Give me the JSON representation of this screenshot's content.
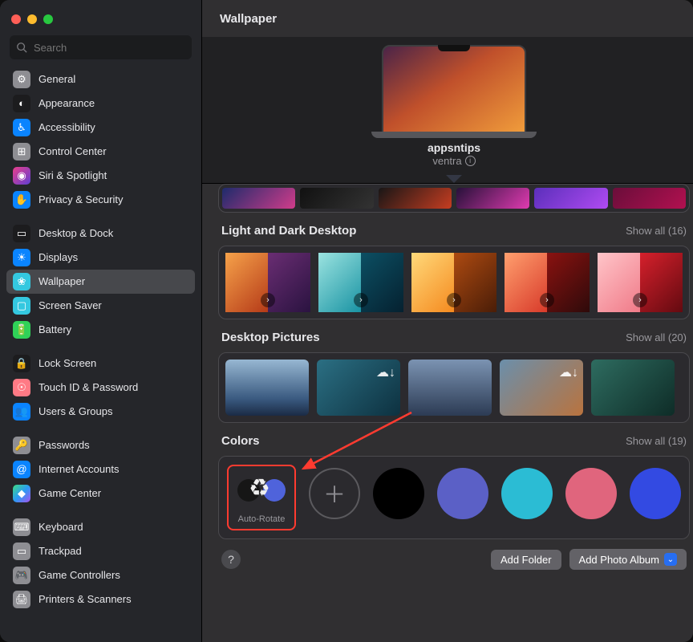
{
  "window_title": "Wallpaper",
  "search": {
    "placeholder": "Search"
  },
  "sidebar": {
    "groups": [
      [
        {
          "label": "General",
          "icon": "⚙︎",
          "bg": "#8e8e93"
        },
        {
          "label": "Appearance",
          "icon": "◐",
          "bg": "#1c1c1e"
        },
        {
          "label": "Accessibility",
          "icon": "♿︎",
          "bg": "#0a84ff"
        },
        {
          "label": "Control Center",
          "icon": "⊞",
          "bg": "#8e8e93"
        },
        {
          "label": "Siri & Spotlight",
          "icon": "◉",
          "bg": "linear-gradient(135deg,#ea3f8b,#5f3fd3)"
        },
        {
          "label": "Privacy & Security",
          "icon": "✋",
          "bg": "#0a84ff"
        }
      ],
      [
        {
          "label": "Desktop & Dock",
          "icon": "▭",
          "bg": "#1c1c1e"
        },
        {
          "label": "Displays",
          "icon": "☀︎",
          "bg": "#0a84ff"
        },
        {
          "label": "Wallpaper",
          "icon": "❀",
          "bg": "#34c8e0",
          "selected": true
        },
        {
          "label": "Screen Saver",
          "icon": "▢",
          "bg": "#34c8e0"
        },
        {
          "label": "Battery",
          "icon": "🔋",
          "bg": "#30d158"
        }
      ],
      [
        {
          "label": "Lock Screen",
          "icon": "🔒",
          "bg": "#1c1c1e"
        },
        {
          "label": "Touch ID & Password",
          "icon": "☉",
          "bg": "#ff7a85"
        },
        {
          "label": "Users & Groups",
          "icon": "👥",
          "bg": "#0a84ff"
        }
      ],
      [
        {
          "label": "Passwords",
          "icon": "🔑",
          "bg": "#8e8e93"
        },
        {
          "label": "Internet Accounts",
          "icon": "@",
          "bg": "#0a84ff"
        },
        {
          "label": "Game Center",
          "icon": "◆",
          "bg": "linear-gradient(135deg,#3edc81,#2b9bf4,#a852ef)"
        }
      ],
      [
        {
          "label": "Keyboard",
          "icon": "⌨︎",
          "bg": "#8e8e93"
        },
        {
          "label": "Trackpad",
          "icon": "▭",
          "bg": "#8e8e93"
        },
        {
          "label": "Game Controllers",
          "icon": "🎮",
          "bg": "#8e8e93"
        },
        {
          "label": "Printers & Scanners",
          "icon": "🖨",
          "bg": "#8e8e93"
        }
      ]
    ]
  },
  "hero": {
    "title": "appsntips",
    "subtitle": "ventra"
  },
  "preview_strip": [
    "linear-gradient(135deg,#1e2b6b,#d13c8b)",
    "linear-gradient(135deg,#111,#333)",
    "linear-gradient(135deg,#181616,#c63d21)",
    "linear-gradient(135deg,#27113a,#e03bb0)",
    "linear-gradient(135deg,#5b2fbb,#b04bf2)",
    "linear-gradient(135deg,#6a0e3a,#b21050)"
  ],
  "sections": {
    "light_dark": {
      "title": "Light and Dark Desktop",
      "show_all": "Show all (16)",
      "items": [
        {
          "l": "linear-gradient(135deg,#f6a24a,#b53a18)",
          "r": "linear-gradient(135deg,#6a2d73,#2a1340)"
        },
        {
          "l": "linear-gradient(135deg,#9be3e0,#1993a3)",
          "r": "linear-gradient(135deg,#0c4f63,#052130)"
        },
        {
          "l": "linear-gradient(135deg,#ffd97a,#f58a1f)",
          "r": "linear-gradient(135deg,#ad4a11,#4a1d07)"
        },
        {
          "l": "linear-gradient(135deg,#ff9f6e,#d83a2a)",
          "r": "linear-gradient(135deg,#8a1210,#2e0a0a)"
        },
        {
          "l": "linear-gradient(135deg,#ffc5c9,#f07a88)",
          "r": "linear-gradient(135deg,#d6202c,#630a10)"
        }
      ]
    },
    "desktop_pictures": {
      "title": "Desktop Pictures",
      "show_all": "Show all (20)",
      "items": [
        {
          "bg": "linear-gradient(180deg,#97b7d2 0%,#3a5a80 70%,#1b2b45 100%)"
        },
        {
          "bg": "linear-gradient(135deg,#2b6f83,#0d3140)",
          "cloud": true
        },
        {
          "bg": "linear-gradient(180deg,#7b93b2,#2c3b54)"
        },
        {
          "bg": "linear-gradient(135deg,#6b8fab,#b9733e)",
          "cloud": true
        },
        {
          "bg": "linear-gradient(135deg,#2e6c60,#0e2c27)"
        }
      ]
    },
    "colors": {
      "title": "Colors",
      "show_all": "Show all (19)",
      "auto_rotate": "Auto-Rotate",
      "swatches": [
        "#000000",
        "#5b60c6",
        "#2bbcd4",
        "#e0657d",
        "#334ae2"
      ]
    }
  },
  "footer": {
    "help": "?",
    "add_folder": "Add Folder",
    "add_album": "Add Photo Album"
  }
}
